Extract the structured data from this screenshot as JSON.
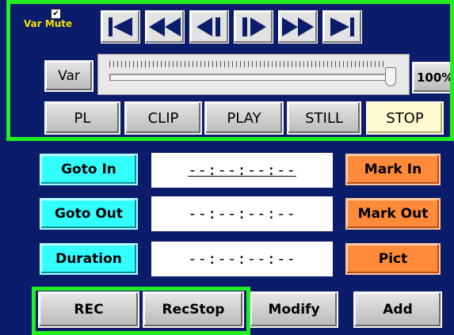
{
  "transport": {
    "var_mute_checked": true,
    "var_mute_label": "Var Mute",
    "buttons": [
      {
        "name": "skip-to-start-button",
        "icon": "skip-to-start-icon"
      },
      {
        "name": "rewind-button",
        "icon": "rewind-icon"
      },
      {
        "name": "step-back-button",
        "icon": "step-back-icon"
      },
      {
        "name": "step-forward-button",
        "icon": "step-forward-icon"
      },
      {
        "name": "fast-forward-button",
        "icon": "fast-forward-icon"
      },
      {
        "name": "skip-to-end-button",
        "icon": "skip-to-end-icon"
      }
    ]
  },
  "speed": {
    "var_label": "Var",
    "percent_label": "100%",
    "slider_fraction": 1.0
  },
  "modes": {
    "pl": "PL",
    "clip": "CLIP",
    "play": "PLAY",
    "still": "STILL",
    "stop": "STOP",
    "active": "stop"
  },
  "edit": {
    "goto_in": "Goto In",
    "goto_out": "Goto Out",
    "duration": "Duration",
    "in_timecode": "--:--:--:--",
    "out_timecode": "--:--:--:--",
    "duration_timecode": "--:--:--:--",
    "mark_in": "Mark In",
    "mark_out": "Mark Out",
    "pict": "Pict"
  },
  "record": {
    "rec": "REC",
    "rec_stop": "RecStop",
    "modify": "Modify",
    "add": "Add"
  },
  "colors": {
    "panel_bg": "#0b1c6a",
    "highlight": "#22ee22",
    "cyan_button": "#33ffff",
    "orange_button": "#ff8a3a",
    "active_mode": "#fffbd0",
    "var_mute_text": "#f0e000"
  }
}
